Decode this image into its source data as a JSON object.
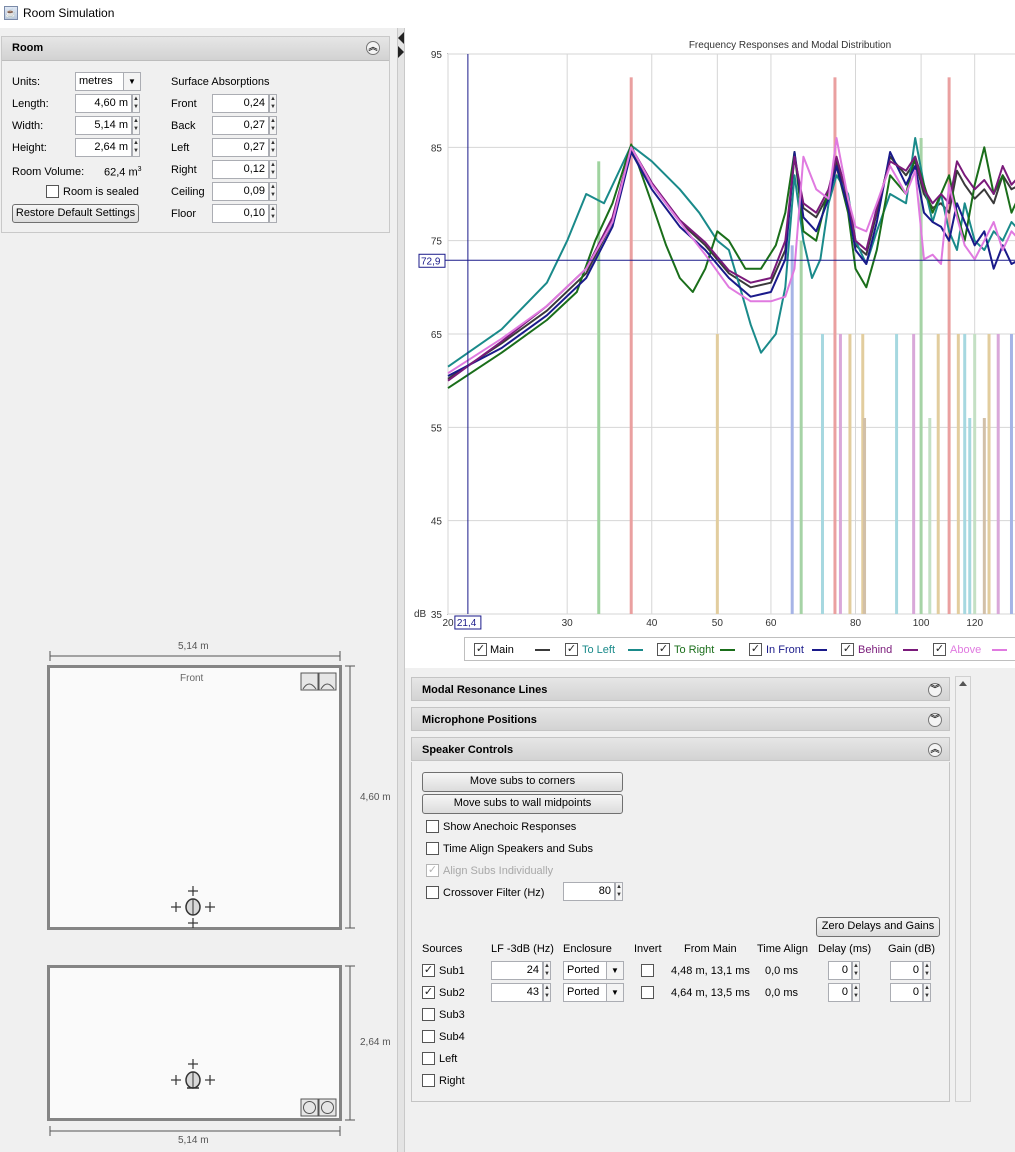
{
  "window": {
    "title": "Room Simulation"
  },
  "room_panel": {
    "title": "Room",
    "units_label": "Units:",
    "units_value": "metres",
    "length_label": "Length:",
    "length_value": "4,60 m",
    "width_label": "Width:",
    "width_value": "5,14 m",
    "height_label": "Height:",
    "height_value": "2,64 m",
    "volume_label": "Room Volume:",
    "volume_value": "62,4 m",
    "volume_sup": "3",
    "sealed_label": "Room is sealed",
    "restore_button": "Restore Default Settings",
    "absorption_title": "Surface Absorptions",
    "surfaces": [
      {
        "label": "Front",
        "value": "0,24"
      },
      {
        "label": "Back",
        "value": "0,27"
      },
      {
        "label": "Left",
        "value": "0,27"
      },
      {
        "label": "Right",
        "value": "0,12"
      },
      {
        "label": "Ceiling",
        "value": "0,09"
      },
      {
        "label": "Floor",
        "value": "0,10"
      }
    ]
  },
  "floorplan": {
    "top_width": "5,14 m",
    "front_label": "Front",
    "side_length": "4,60 m",
    "side_height": "2,64 m",
    "bottom_width": "5,14 m"
  },
  "chart_data": {
    "type": "line",
    "title": "Frequency Responses and Modal Distribution",
    "x_scale": "log",
    "xlim": [
      20,
      140
    ],
    "ylim": [
      35,
      95
    ],
    "x_ticks": [
      "20",
      "30",
      "40",
      "50",
      "60",
      "80",
      "100",
      "120"
    ],
    "x_tick_values": [
      20,
      30,
      40,
      50,
      60,
      80,
      100,
      120
    ],
    "y_ticks": [
      "95",
      "85",
      "75",
      "65",
      "55",
      "45",
      "35"
    ],
    "y_tick_values": [
      95,
      85,
      75,
      65,
      55,
      45,
      35
    ],
    "ylabel": "dB",
    "cursor_x": "21,4",
    "cursor_y": "72,9",
    "cursor_x_value": 21.4,
    "cursor_y_value": 72.9,
    "grid": true,
    "series": [
      {
        "name": "Main",
        "color": "#3a3a3a",
        "x": [
          20,
          24,
          28,
          32,
          35,
          37.3,
          40,
          44,
          48,
          52,
          56,
          60,
          63,
          65,
          67,
          70,
          73,
          75,
          78,
          80,
          83,
          86,
          90,
          95,
          98,
          101,
          104,
          107,
          110,
          113,
          116,
          120,
          124,
          128,
          132,
          136,
          140
        ],
        "y": [
          60.2,
          64.0,
          67.5,
          71.5,
          77.0,
          84.8,
          81.0,
          77.0,
          74.5,
          71.5,
          70.0,
          70.5,
          74.0,
          84.0,
          78.5,
          77.5,
          80.0,
          83.5,
          79.0,
          74.5,
          73.5,
          78.0,
          84.0,
          82.0,
          83.5,
          80.0,
          78.5,
          79.0,
          78.0,
          82.5,
          81.0,
          79.5,
          80.5,
          79.0,
          82.0,
          80.5,
          81.0
        ]
      },
      {
        "name": "To Left",
        "color": "#1a8a8a",
        "x": [
          20,
          24,
          28,
          30,
          32,
          34,
          37.3,
          40,
          44,
          47,
          50,
          52,
          54,
          56,
          58,
          61,
          63,
          65,
          67,
          69,
          71,
          73,
          75,
          78,
          80,
          83,
          86,
          90,
          95,
          98,
          101,
          104,
          107,
          110,
          113,
          116,
          120,
          124,
          128,
          132,
          136,
          140
        ],
        "y": [
          61.5,
          65.5,
          70.5,
          75.0,
          80.0,
          79.0,
          85.2,
          83.5,
          80.5,
          78.0,
          75.0,
          74.0,
          70.0,
          66.0,
          63.0,
          65.0,
          70.0,
          82.0,
          75.0,
          71.0,
          73.0,
          79.0,
          82.0,
          80.0,
          75.0,
          72.5,
          76.0,
          80.0,
          79.0,
          86.0,
          81.0,
          77.0,
          80.0,
          76.0,
          74.0,
          79.0,
          75.0,
          74.0,
          76.0,
          75.0,
          77.0,
          76.0
        ]
      },
      {
        "name": "To Right",
        "color": "#1a6e1a",
        "x": [
          20,
          24,
          28,
          31,
          33,
          35,
          37.3,
          40,
          42,
          44,
          46,
          48,
          50,
          52,
          55,
          58,
          61,
          63,
          65,
          67,
          70,
          73,
          75,
          78,
          80,
          83,
          86,
          90,
          95,
          98,
          101,
          104,
          107,
          110,
          113,
          116,
          120,
          124,
          128,
          132,
          136,
          140
        ],
        "y": [
          59.2,
          63.0,
          66.5,
          69.5,
          75.0,
          79.0,
          85.3,
          79.0,
          74.5,
          71.0,
          69.5,
          72.0,
          76.0,
          75.0,
          72.0,
          72.0,
          74.5,
          78.0,
          84.5,
          76.0,
          75.0,
          80.5,
          83.0,
          78.0,
          72.0,
          70.0,
          74.0,
          82.0,
          80.0,
          84.0,
          81.0,
          78.0,
          80.0,
          82.0,
          78.0,
          75.0,
          81.0,
          85.0,
          80.0,
          82.0,
          78.0,
          80.0
        ]
      },
      {
        "name": "In Front",
        "color": "#1a1a8a",
        "x": [
          20,
          24,
          28,
          32,
          35,
          37.3,
          40,
          44,
          48,
          52,
          56,
          60,
          63,
          65,
          67,
          70,
          73,
          75,
          78,
          80,
          83,
          86,
          90,
          95,
          98,
          101,
          104,
          107,
          110,
          113,
          116,
          120,
          124,
          128,
          132,
          136,
          140
        ],
        "y": [
          60.5,
          63.5,
          67.0,
          71.0,
          76.5,
          84.5,
          80.5,
          76.5,
          74.0,
          71.0,
          69.0,
          69.5,
          73.0,
          84.5,
          77.5,
          76.0,
          79.5,
          83.0,
          78.5,
          74.0,
          72.5,
          77.0,
          84.5,
          81.0,
          83.0,
          78.0,
          77.0,
          76.5,
          75.0,
          79.0,
          77.0,
          74.5,
          76.0,
          72.0,
          74.5,
          72.5,
          73.0
        ]
      },
      {
        "name": "Behind",
        "color": "#7a1a7a",
        "x": [
          20,
          24,
          28,
          32,
          35,
          37.3,
          40,
          44,
          48,
          52,
          56,
          60,
          63,
          65,
          67,
          70,
          73,
          75,
          78,
          80,
          83,
          86,
          90,
          95,
          98,
          101,
          104,
          107,
          110,
          113,
          116,
          120,
          124,
          128,
          132,
          136,
          140
        ],
        "y": [
          60.0,
          64.2,
          68.0,
          72.0,
          77.5,
          85.0,
          81.2,
          77.2,
          74.8,
          71.8,
          70.5,
          71.0,
          75.0,
          84.0,
          79.0,
          78.0,
          80.5,
          84.0,
          79.5,
          75.0,
          74.0,
          78.5,
          83.5,
          82.5,
          84.0,
          80.5,
          79.0,
          80.0,
          79.0,
          83.5,
          82.0,
          80.5,
          81.5,
          80.0,
          83.0,
          81.0,
          82.0
        ]
      },
      {
        "name": "Above",
        "color": "#e07ae0",
        "x": [
          20,
          24,
          28,
          32,
          35,
          37.3,
          40,
          44,
          48,
          52,
          56,
          60,
          63,
          65,
          67,
          70,
          73,
          75,
          78,
          80,
          83,
          86,
          90,
          95,
          98,
          101,
          104,
          107,
          110,
          113,
          116,
          120,
          124,
          128,
          132,
          136,
          140
        ],
        "y": [
          60.8,
          64.5,
          68.0,
          72.0,
          77.0,
          85.0,
          81.0,
          77.0,
          73.5,
          70.0,
          68.5,
          68.5,
          69.0,
          72.0,
          84.0,
          80.5,
          79.5,
          86.0,
          79.5,
          76.5,
          76.0,
          79.0,
          83.0,
          80.0,
          82.5,
          73.0,
          73.5,
          72.5,
          81.0,
          77.5,
          74.5,
          73.0,
          75.0,
          77.0,
          74.0,
          76.0,
          75.0
        ]
      }
    ],
    "modal_lines": [
      {
        "x": 33.4,
        "top": 83.5,
        "color": "#9fd39f"
      },
      {
        "x": 37.3,
        "top": 92.5,
        "color": "#eaa0a0"
      },
      {
        "x": 50.0,
        "top": 65.0,
        "color": "#e2cd9e"
      },
      {
        "x": 64.5,
        "top": 74.5,
        "color": "#a6b4e6"
      },
      {
        "x": 66.5,
        "top": 75.0,
        "color": "#a6d3a6"
      },
      {
        "x": 71.5,
        "top": 65.0,
        "color": "#a6d8e0"
      },
      {
        "x": 74.6,
        "top": 92.5,
        "color": "#eaa0a0"
      },
      {
        "x": 76.0,
        "top": 65.0,
        "color": "#d9a8d9"
      },
      {
        "x": 78.5,
        "top": 65.0,
        "color": "#e2cd9e"
      },
      {
        "x": 82.0,
        "top": 65.0,
        "color": "#e2cd9e"
      },
      {
        "x": 82.5,
        "top": 56.0,
        "color": "#d2c0a8"
      },
      {
        "x": 92.0,
        "top": 65.0,
        "color": "#a6d8e0"
      },
      {
        "x": 97.5,
        "top": 65.0,
        "color": "#d9a8d9"
      },
      {
        "x": 100.0,
        "top": 86.0,
        "color": "#a6d3a6"
      },
      {
        "x": 103.0,
        "top": 56.0,
        "color": "#c4e0c4"
      },
      {
        "x": 106.0,
        "top": 65.0,
        "color": "#e2cd9e"
      },
      {
        "x": 110.0,
        "top": 92.5,
        "color": "#eaa0a0"
      },
      {
        "x": 113.5,
        "top": 65.0,
        "color": "#e2cd9e"
      },
      {
        "x": 116.0,
        "top": 65.0,
        "color": "#a6d8e0"
      },
      {
        "x": 118.0,
        "top": 56.0,
        "color": "#a6d8e0"
      },
      {
        "x": 120.0,
        "top": 65.0,
        "color": "#c4e0c4"
      },
      {
        "x": 124.0,
        "top": 56.0,
        "color": "#d2c0a8"
      },
      {
        "x": 126.0,
        "top": 65.0,
        "color": "#e2cd9e"
      },
      {
        "x": 130.0,
        "top": 65.0,
        "color": "#d9a8d9"
      },
      {
        "x": 136.0,
        "top": 65.0,
        "color": "#a6b4e6"
      }
    ]
  },
  "legend": {
    "items": [
      {
        "label": "Main",
        "color": "#3a3a3a",
        "text_color": "#000000"
      },
      {
        "label": "To Left",
        "color": "#1a8a8a",
        "text_color": "#1a8a8a"
      },
      {
        "label": "To Right",
        "color": "#1a6e1a",
        "text_color": "#1a6e1a"
      },
      {
        "label": "In Front",
        "color": "#1a1a8a",
        "text_color": "#1a1a8a"
      },
      {
        "label": "Behind",
        "color": "#7a1a7a",
        "text_color": "#7a1a7a"
      },
      {
        "label": "Above",
        "color": "#e07ae0",
        "text_color": "#e07ae0"
      }
    ]
  },
  "sections": {
    "modal": "Modal Resonance Lines",
    "mic": "Microphone Positions",
    "speaker": "Speaker Controls"
  },
  "speaker_controls": {
    "move_corners": "Move subs to corners",
    "move_midpoints": "Move subs to wall midpoints",
    "show_anechoic": "Show Anechoic Responses",
    "time_align": "Time Align Speakers and Subs",
    "align_individually": "Align Subs Individually",
    "crossover": "Crossover Filter (Hz)",
    "crossover_value": "80",
    "zero_button": "Zero Delays and Gains",
    "headers": {
      "sources": "Sources",
      "lf3db": "LF -3dB (Hz)",
      "enclosure": "Enclosure",
      "invert": "Invert",
      "from_main": "From Main",
      "time_align": "Time Align",
      "delay": "Delay (ms)",
      "gain": "Gain (dB)"
    },
    "sources": [
      {
        "name": "Sub1",
        "checked": true,
        "lf": "24",
        "enclosure": "Ported",
        "from_main": "4,48 m, 13,1 ms",
        "time_align": "0,0 ms",
        "delay": "0",
        "gain": "0"
      },
      {
        "name": "Sub2",
        "checked": true,
        "lf": "43",
        "enclosure": "Ported",
        "from_main": "4,64 m, 13,5 ms",
        "time_align": "0,0 ms",
        "delay": "0",
        "gain": "0"
      },
      {
        "name": "Sub3",
        "checked": false
      },
      {
        "name": "Sub4",
        "checked": false
      },
      {
        "name": "Left",
        "checked": false
      },
      {
        "name": "Right",
        "checked": false
      }
    ]
  }
}
